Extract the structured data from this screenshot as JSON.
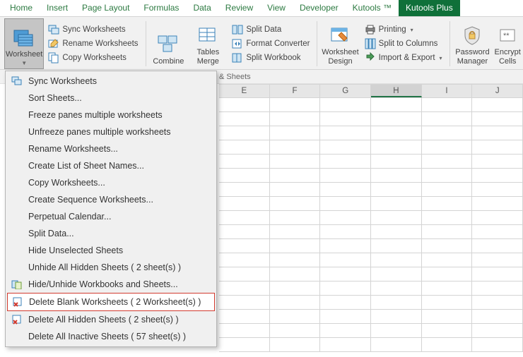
{
  "tabs": [
    "Home",
    "Insert",
    "Page Layout",
    "Formulas",
    "Data",
    "Review",
    "View",
    "Developer",
    "Kutools ™",
    "Kutools Plus"
  ],
  "active_tab": "Kutools Plus",
  "ribbon": {
    "worksheet": "Worksheet",
    "sync_ws": "Sync Worksheets",
    "rename_ws": "Rename Worksheets",
    "copy_ws": "Copy Worksheets",
    "combine": "Combine",
    "tables_merge": "Tables\nMerge",
    "split_data": "Split Data",
    "format_conv": "Format Converter",
    "split_wb": "Split Workbook",
    "ws_design": "Worksheet\nDesign",
    "printing": "Printing",
    "split_cols": "Split to Columns",
    "import_export": "Import & Export",
    "pw_mgr": "Password\nManager",
    "encrypt": "Encrypt\nCells",
    "group_label": "& Sheets"
  },
  "menu": [
    "Sync Worksheets",
    "Sort Sheets...",
    "Freeze panes multiple worksheets",
    "Unfreeze panes multiple worksheets",
    "Rename Worksheets...",
    "Create List of Sheet Names...",
    "Copy Worksheets...",
    "Create Sequence Worksheets...",
    "Perpetual Calendar...",
    "Split Data...",
    "Hide Unselected Sheets",
    "Unhide All Hidden Sheets ( 2 sheet(s) )",
    "Hide/Unhide Workbooks and Sheets...",
    "Delete Blank Worksheets ( 2 Worksheet(s) )",
    "Delete All Hidden Sheets ( 2 sheet(s) )",
    "Delete All Inactive Sheets ( 57 sheet(s) )"
  ],
  "highlight_index": 13,
  "columns": [
    "E",
    "F",
    "G",
    "H",
    "I",
    "J"
  ],
  "selected_column": "H"
}
